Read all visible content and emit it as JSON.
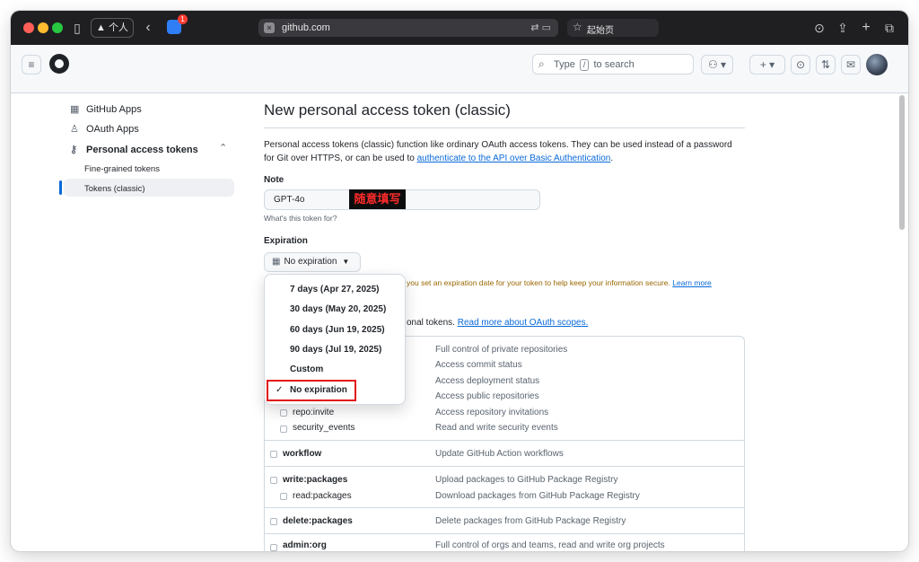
{
  "browser": {
    "profile_label": "个人",
    "extension_badge": "1",
    "url": "github.com",
    "tab_label": "起始页"
  },
  "header": {
    "search_prefix": "Type",
    "search_key": "/",
    "search_suffix": "to search"
  },
  "sidebar": {
    "items": [
      {
        "label": "GitHub Apps",
        "icon": "apps-grid-icon"
      },
      {
        "label": "OAuth Apps",
        "icon": "person-icon"
      },
      {
        "label": "Personal access tokens",
        "icon": "key-icon"
      }
    ],
    "sub_items": [
      {
        "label": "Fine-grained tokens"
      },
      {
        "label": "Tokens (classic)"
      }
    ]
  },
  "main": {
    "title": "New personal access token (classic)",
    "desc_part1": "Personal access tokens (classic) function like ordinary OAuth access tokens. They can be used instead of a password for Git over HTTPS, or can be used to ",
    "desc_link": "authenticate to the API over Basic Authentication",
    "desc_end": ".",
    "note_label": "Note",
    "note_value": "GPT-4o",
    "annotation": "随意填写",
    "note_hint": "What's this token for?",
    "expiration_label": "Expiration",
    "expiration_value": "No expiration",
    "warning_text": "you set an expiration date for your token to help keep your information secure.",
    "warning_link": "Learn more",
    "scopes_text": "onal tokens.",
    "scopes_link": "Read more about OAuth scopes."
  },
  "dropdown": {
    "options": [
      {
        "label": "7 days (Apr 27, 2025)"
      },
      {
        "label": "30 days (May 20, 2025)"
      },
      {
        "label": "60 days (Jun 19, 2025)"
      },
      {
        "label": "90 days (Jul 19, 2025)"
      },
      {
        "label": "Custom"
      },
      {
        "label": "No expiration",
        "selected": true
      }
    ],
    "check": "✓"
  },
  "scopes": {
    "repo_sub": [
      {
        "desc": "Full control of private repositories"
      },
      {
        "desc": "Access commit status"
      },
      {
        "desc": "Access deployment status"
      },
      {
        "desc": "Access public repositories"
      },
      {
        "name": "repo:invite",
        "desc": "Access repository invitations"
      },
      {
        "name": "security_events",
        "desc": "Read and write security events"
      }
    ],
    "workflow": {
      "name": "workflow",
      "desc": "Update GitHub Action workflows"
    },
    "write_packages": {
      "name": "write:packages",
      "desc": "Upload packages to GitHub Package Registry"
    },
    "read_packages": {
      "name": "read:packages",
      "desc": "Download packages from GitHub Package Registry"
    },
    "delete_packages": {
      "name": "delete:packages",
      "desc": "Delete packages from GitHub Package Registry"
    },
    "admin_org": {
      "name": "admin:org",
      "desc": "Full control of orgs and teams, read and write org projects"
    }
  }
}
